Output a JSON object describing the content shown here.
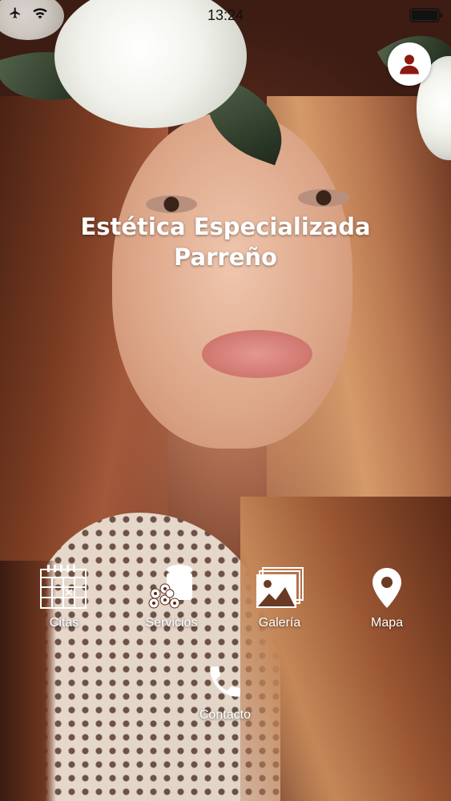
{
  "status_bar": {
    "time": "13:24",
    "left_icons": [
      "airplane-icon",
      "wifi-icon"
    ],
    "right_icons": [
      "battery-icon"
    ]
  },
  "header": {
    "title_line1": "Estética Especializada",
    "title_line2": "Parreño",
    "profile_icon": "user-icon"
  },
  "menu": {
    "items": [
      {
        "label": "Citas",
        "icon": "calendar-icon"
      },
      {
        "label": "Servicios",
        "icon": "flower-jar-icon"
      },
      {
        "label": "Galería",
        "icon": "gallery-icon"
      },
      {
        "label": "Mapa",
        "icon": "map-pin-icon"
      },
      {
        "label": "Contacto",
        "icon": "phone-icon"
      }
    ]
  },
  "colors": {
    "accent": "#8b1a12",
    "text": "#ffffff"
  }
}
